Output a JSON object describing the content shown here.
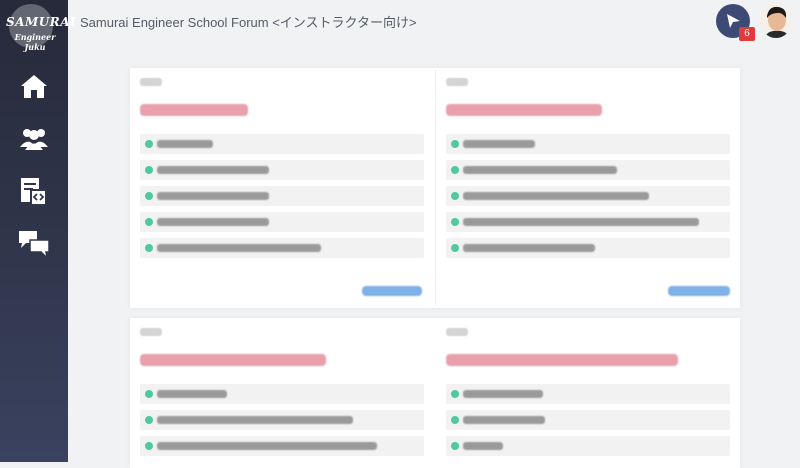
{
  "app": {
    "title": "Samurai Engineer School Forum <インストラクター向け>",
    "logo_line1": "SAMURAI",
    "logo_line2": "Engineer Juku"
  },
  "sidebar": {
    "items": [
      {
        "icon": "home-icon"
      },
      {
        "icon": "users-icon"
      },
      {
        "icon": "code-document-icon"
      },
      {
        "icon": "chat-icon"
      }
    ]
  },
  "header": {
    "notification_icon": "cursor-arrow-icon",
    "notification_count": "6",
    "notification_color": "#3d4a75",
    "badge_color": "#e03a3a"
  },
  "colors": {
    "sidebar_top": "#262a3a",
    "sidebar_bottom": "#3a4260",
    "category_title": "#e8a0ad",
    "dot": "#4ec9a3",
    "more_link": "#7fb0e6"
  }
}
